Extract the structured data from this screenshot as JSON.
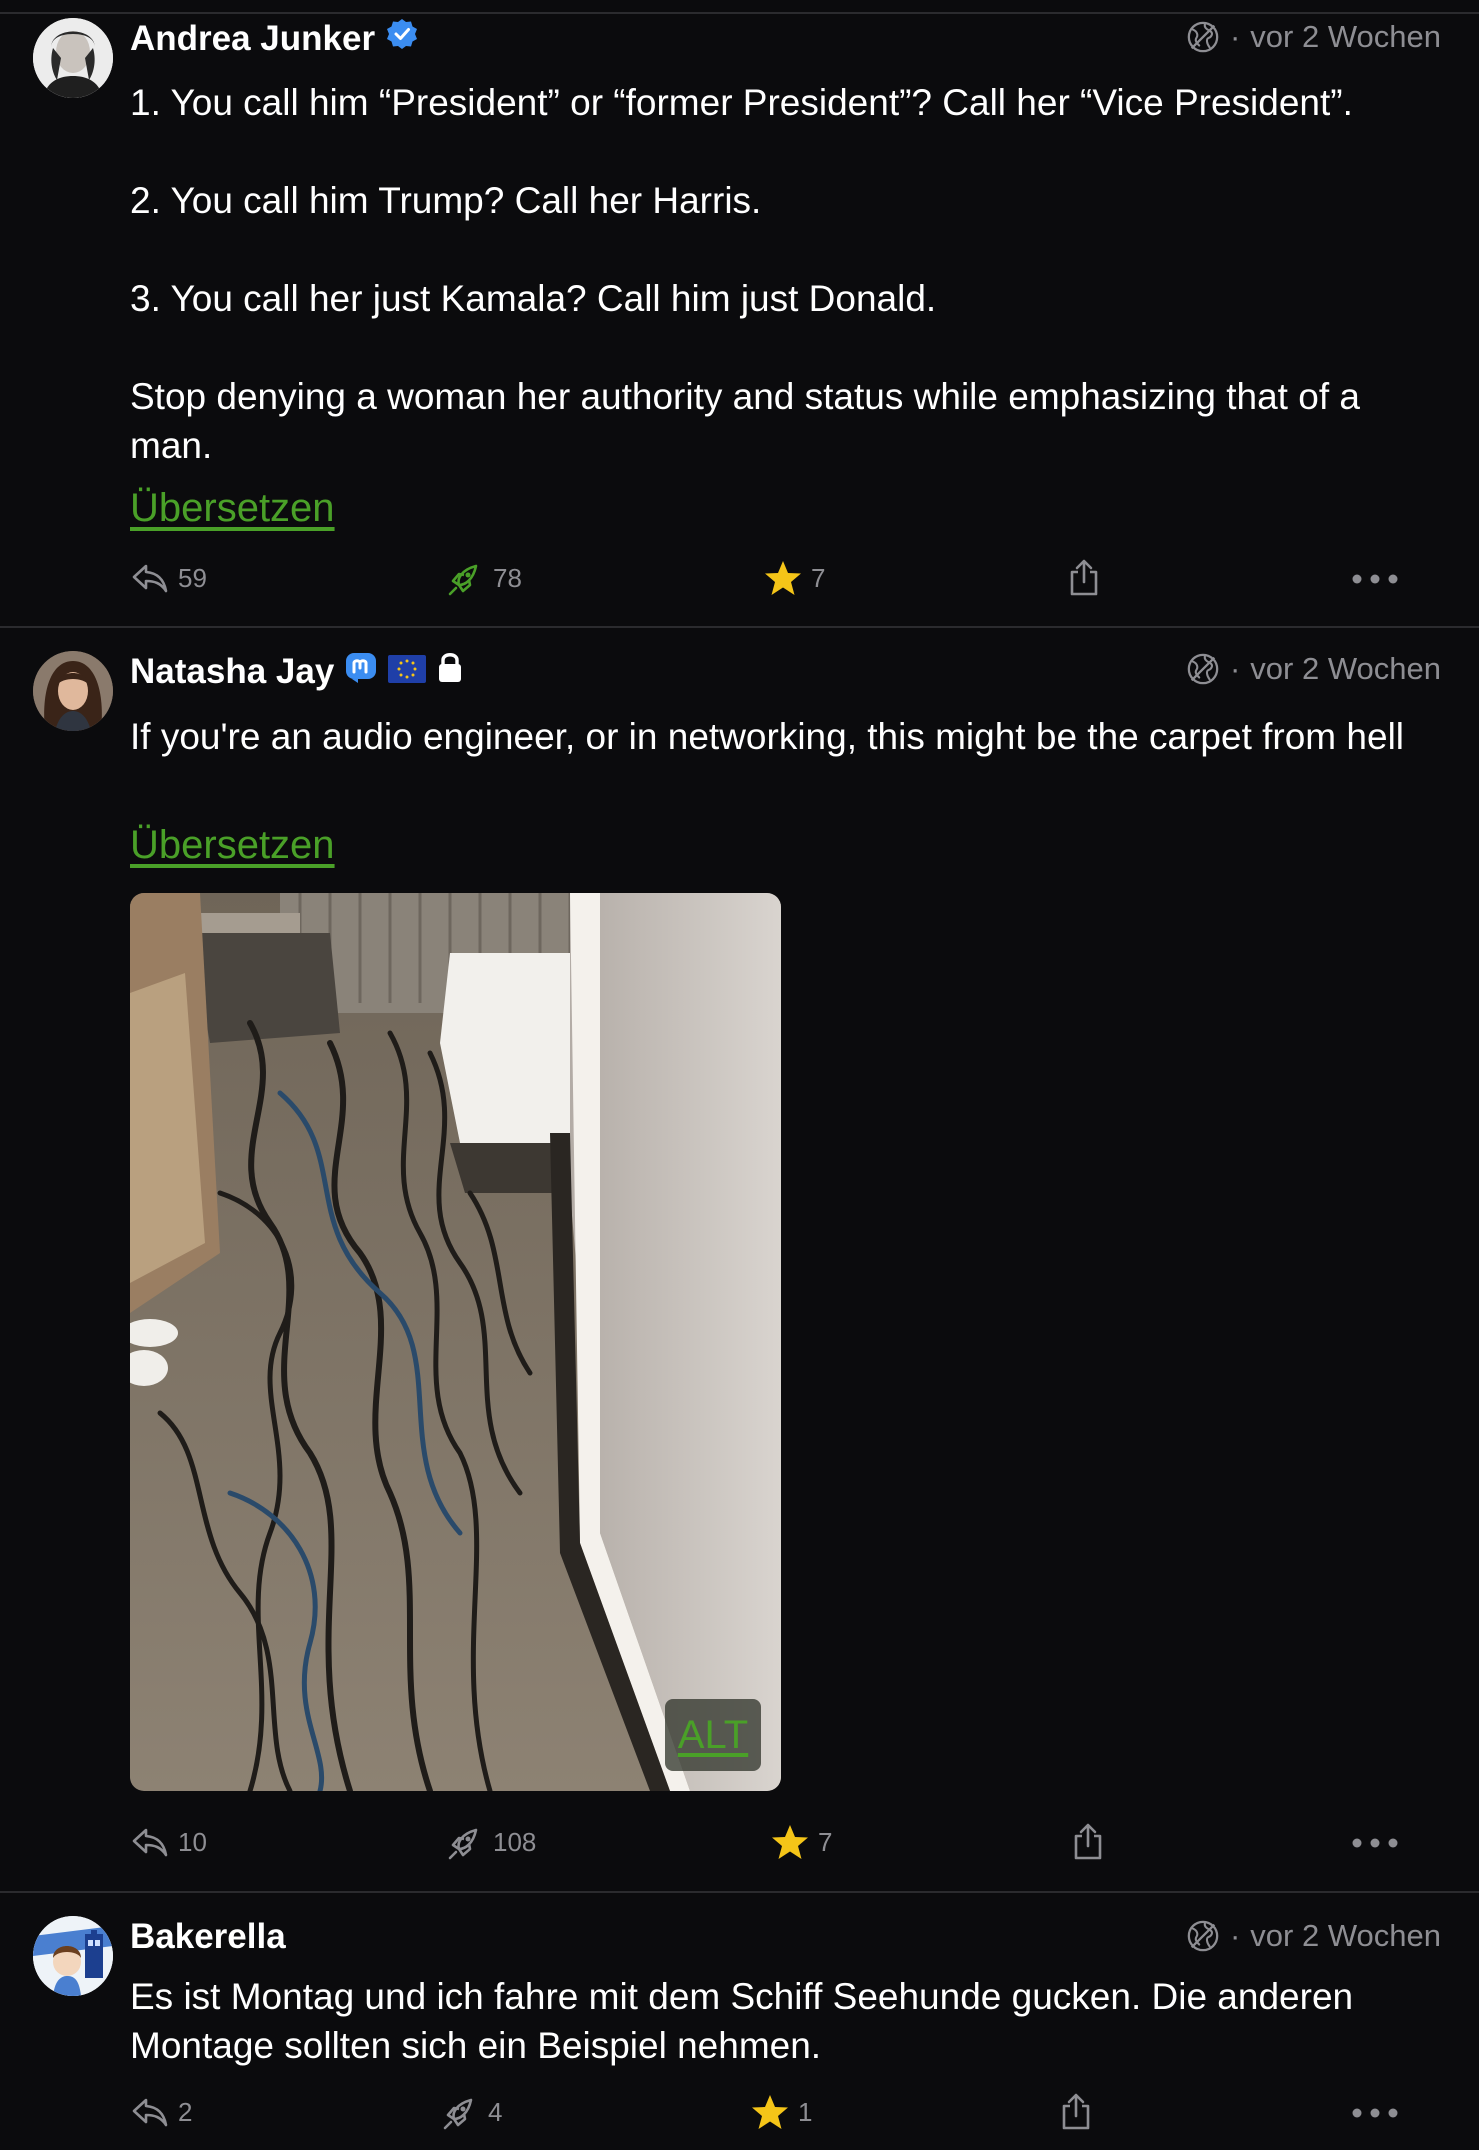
{
  "posts": [
    {
      "author": "Andrea Junker",
      "time": "vor 2 Wochen",
      "paragraphs": [
        "1. You call him “President” or “former President”? Call her “Vice President”.",
        "2. You call him Trump? Call her Harris.",
        "3. You call her just Kamala? Call him just Donald.",
        "Stop denying a woman her authority and status while emphasizing that of a man."
      ],
      "translate": "Übersetzen",
      "replies": "59",
      "boosts": "78",
      "favourites": "7"
    },
    {
      "author": "Natasha Jay",
      "time": "vor 2 Wochen",
      "text": "If you're an audio engineer, or in networking, this might be the carpet from hell",
      "translate": "Übersetzen",
      "alt_label": "ALT",
      "replies": "10",
      "boosts": "108",
      "favourites": "7"
    },
    {
      "author": "Bakerella",
      "time": "vor 2 Wochen",
      "text": "Es ist Montag und ich fahre mit dem Schiff Seehunde gucken. Die anderen Montage sollten sich ein Beispiel nehmen.",
      "replies": "2",
      "boosts": "4",
      "favourites": "1"
    }
  ],
  "colors": {
    "background": "#0b0b0d",
    "accent_green": "#4aa028",
    "muted": "#8e8e93",
    "star": "#f5c518",
    "verified": "#3b8df1"
  },
  "icons": [
    "reply-icon",
    "boost-icon",
    "star-icon",
    "share-icon",
    "more-icon",
    "globe-icon",
    "verified-icon",
    "mastodon-icon",
    "eu-flag-icon",
    "lock-icon"
  ]
}
